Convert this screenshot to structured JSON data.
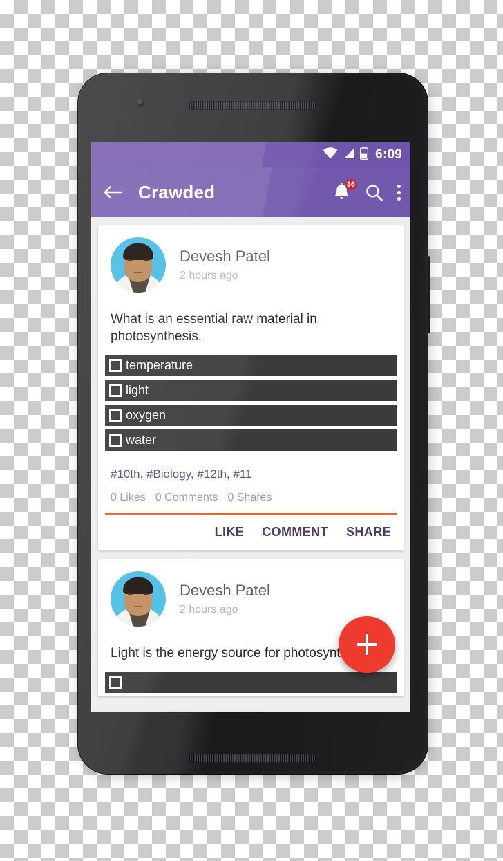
{
  "status_bar": {
    "time": "6:09",
    "wifi_icon": "wifi-icon",
    "signal_icon": "cellular-signal-icon",
    "battery_icon": "battery-icon"
  },
  "app_bar": {
    "back_icon": "back-arrow-icon",
    "title": "Crawded",
    "notification_icon": "bell-icon",
    "notification_count": "36",
    "search_icon": "search-icon",
    "overflow_icon": "overflow-menu-icon"
  },
  "colors": {
    "status_bar": "#6F54AB",
    "app_bar": "#7259AD",
    "screen_background": "#EEEEEE",
    "card": "#FFFFFF",
    "poll_option": "#3B3B3B",
    "tag_text": "#5B4A8E",
    "action_text": "#4A3B70",
    "divider_orange": "#E8622A",
    "fab": "#EE3B2E",
    "badge": "#E02020",
    "avatar_background": "#4CBDE4"
  },
  "fab": {
    "icon": "plus-icon",
    "label": "+"
  },
  "posts": [
    {
      "author": "Devesh Patel",
      "time": "2 hours ago",
      "text": "What is an essential raw material in photosynthesis.",
      "poll_options": [
        "temperature",
        "light",
        "oxygen",
        "water"
      ],
      "tags": "#10th, #Biology, #12th, #11",
      "stats": {
        "likes": "0 Likes",
        "comments": "0 Comments",
        "shares": "0 Shares"
      },
      "actions": {
        "like": "LIKE",
        "comment": "COMMENT",
        "share": "SHARE"
      }
    },
    {
      "author": "Devesh Patel",
      "time": "2 hours ago",
      "text": "Light is the energy source for photosynthesis."
    }
  ]
}
